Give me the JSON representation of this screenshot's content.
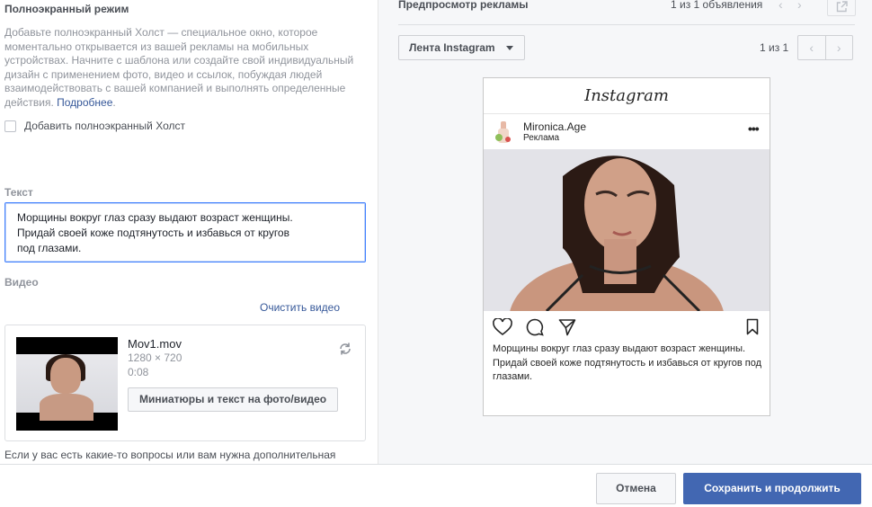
{
  "fullscreen": {
    "title": "Полноэкранный режим",
    "description": "Добавьте полноэкранный Холст — специальное окно, которое моментально открывается из вашей рекламы на мобильных устройствах. Начните с шаблона или создайте свой индивидуальный дизайн с применением фото, видео и ссылок, побуждая людей взаимодействовать с вашей компанией и выполнять определенные действия.",
    "learn_more": "Подробнее",
    "checkbox_label": "Добавить полноэкранный Холст"
  },
  "text_section": {
    "label": "Текст",
    "lines": [
      "Морщины вокруг глаз сразу выдают возраст женщины.",
      "Придай своей коже подтянутость и избавься от кругов",
      "под глазами."
    ]
  },
  "video_section": {
    "label": "Видео",
    "clear_link": "Очистить видео",
    "file_name": "Mov1.mov",
    "dimensions": "1280 × 720",
    "duration": "0:08",
    "thumbs_button": "Миниатюры и текст на фото/видео",
    "help_text": "Если у вас есть какие-то вопросы или вам нужна дополнительная"
  },
  "preview": {
    "title": "Предпросмотр рекламы",
    "ads_count": "1 из 1 объявления",
    "placement": "Лента Instagram",
    "page_count": "1 из 1",
    "ig_logo": "Instagram",
    "username": "Mironica.Age",
    "sponsored": "Реклама",
    "caption": "Морщины вокруг глаз сразу выдают возраст женщины. Придай своей коже подтянутость и избавься от кругов под глазами."
  },
  "footer": {
    "cancel": "Отмена",
    "save": "Сохранить и продолжить"
  },
  "colors": {
    "primary": "#4267b2",
    "link": "#365899",
    "focus_border": "#4080ff"
  }
}
